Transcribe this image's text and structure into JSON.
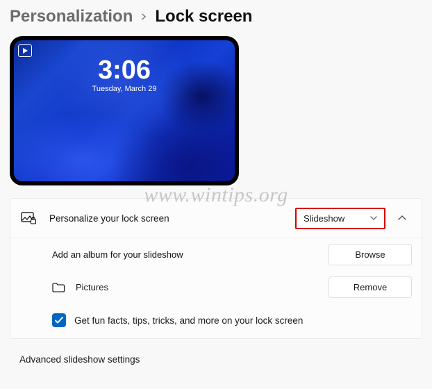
{
  "breadcrumb": {
    "parent": "Personalization",
    "current": "Lock screen"
  },
  "preview": {
    "time": "3:06",
    "date": "Tuesday, March 29"
  },
  "personalize": {
    "label": "Personalize your lock screen",
    "select_value": "Slideshow"
  },
  "slideshow": {
    "add_album_label": "Add an album for your slideshow",
    "browse_label": "Browse",
    "folder_name": "Pictures",
    "remove_label": "Remove",
    "funfacts_label": "Get fun facts, tips, tricks, and more on your lock screen",
    "funfacts_checked": true
  },
  "advanced": {
    "label": "Advanced slideshow settings"
  },
  "watermark": "www.wintips.org"
}
